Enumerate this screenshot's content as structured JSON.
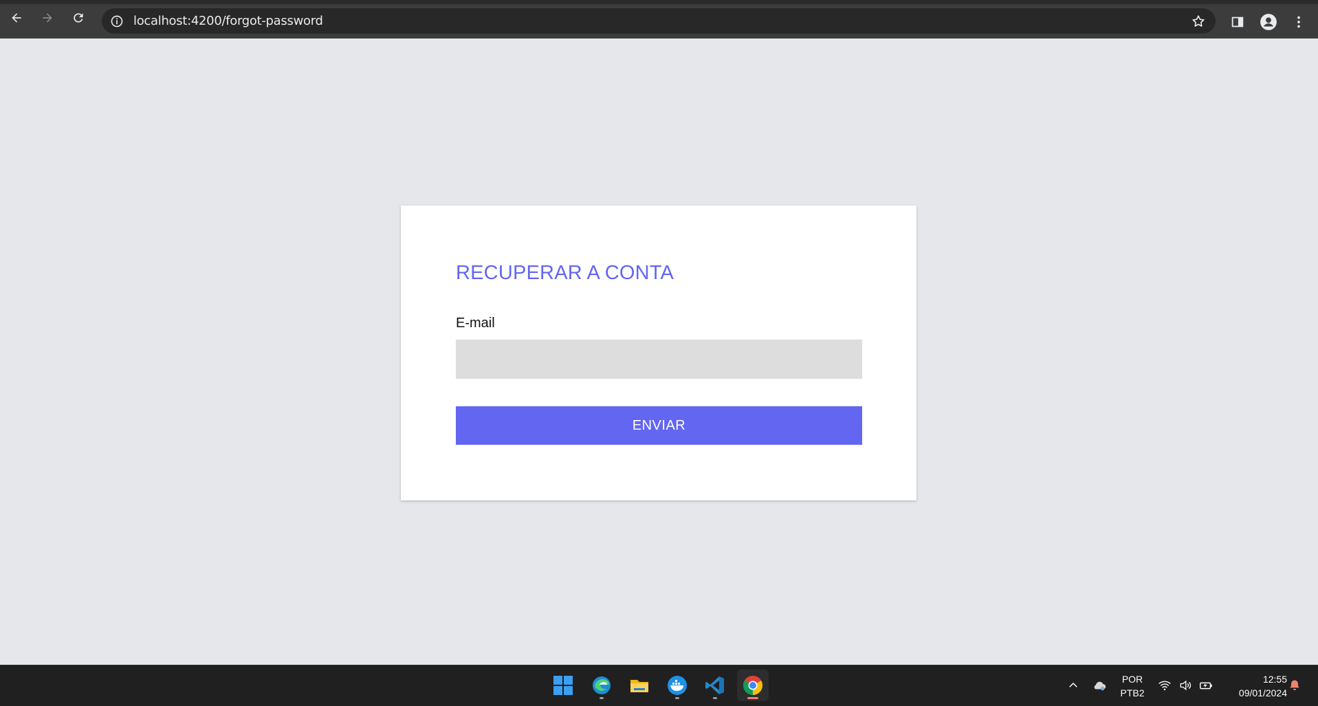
{
  "browser": {
    "url": "localhost:4200/forgot-password"
  },
  "form": {
    "title": "RECUPERAR A CONTA",
    "email_label": "E-mail",
    "email_value": "",
    "email_placeholder": "",
    "submit_label": "ENVIAR"
  },
  "taskbar": {
    "apps": [
      "start-menu",
      "edge",
      "file-explorer",
      "docker-desktop",
      "vscode",
      "chrome"
    ],
    "language_line1": "POR",
    "language_line2": "PTB2",
    "time": "12:55",
    "date": "09/01/2024"
  },
  "colors": {
    "accent": "#6366f1",
    "page_background": "#e5e7eb",
    "input_background": "#dddddd"
  }
}
